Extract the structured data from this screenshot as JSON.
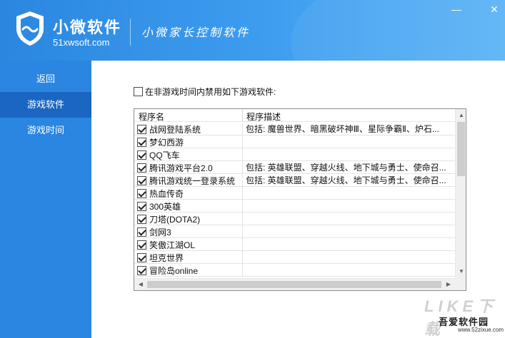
{
  "header": {
    "app_name": "小微软件",
    "url": "51xwsoft.com",
    "slogan": "小微家长控制软件",
    "minimize_label": "—",
    "close_label": "✕"
  },
  "sidebar": {
    "items": [
      {
        "label": "返回",
        "active": false
      },
      {
        "label": "游戏软件",
        "active": true
      },
      {
        "label": "游戏时间",
        "active": false
      }
    ]
  },
  "main": {
    "ban_checkbox": {
      "label": "在非游戏时间内禁用如下游戏软件:",
      "checked": false
    },
    "table": {
      "columns": [
        "程序名",
        "程序描述"
      ],
      "rows": [
        {
          "name": "战网登陆系统",
          "desc": "包括: 魔兽世界、暗黑破坏神Ⅲ、星际争霸Ⅱ、炉石...",
          "checked": true
        },
        {
          "name": "梦幻西游",
          "desc": "",
          "checked": true
        },
        {
          "name": "QQ飞车",
          "desc": "",
          "checked": true
        },
        {
          "name": "腾讯游戏平台2.0",
          "desc": "包括: 英雄联盟、穿越火线、地下城与勇士、使命召...",
          "checked": true
        },
        {
          "name": "腾讯游戏统一登录系统",
          "desc": "包括: 英雄联盟、穿越火线、地下城与勇士、使命召...",
          "checked": true
        },
        {
          "name": "热血传奇",
          "desc": "",
          "checked": true
        },
        {
          "name": "300英雄",
          "desc": "",
          "checked": true
        },
        {
          "name": "刀塔(DOTA2)",
          "desc": "",
          "checked": true
        },
        {
          "name": "剑网3",
          "desc": "",
          "checked": true
        },
        {
          "name": "笑傲江湖OL",
          "desc": "",
          "checked": true
        },
        {
          "name": "坦克世界",
          "desc": "",
          "checked": true
        },
        {
          "name": "冒险岛online",
          "desc": "",
          "checked": true
        }
      ]
    }
  },
  "watermark": {
    "big": "LIKE下载",
    "name": "吾爱软件园",
    "url": "www.52zixue.com"
  },
  "colors": {
    "header_start": "#2a86df",
    "sidebar": "#2a86e0",
    "sidebar_active": "#1a66c0"
  }
}
